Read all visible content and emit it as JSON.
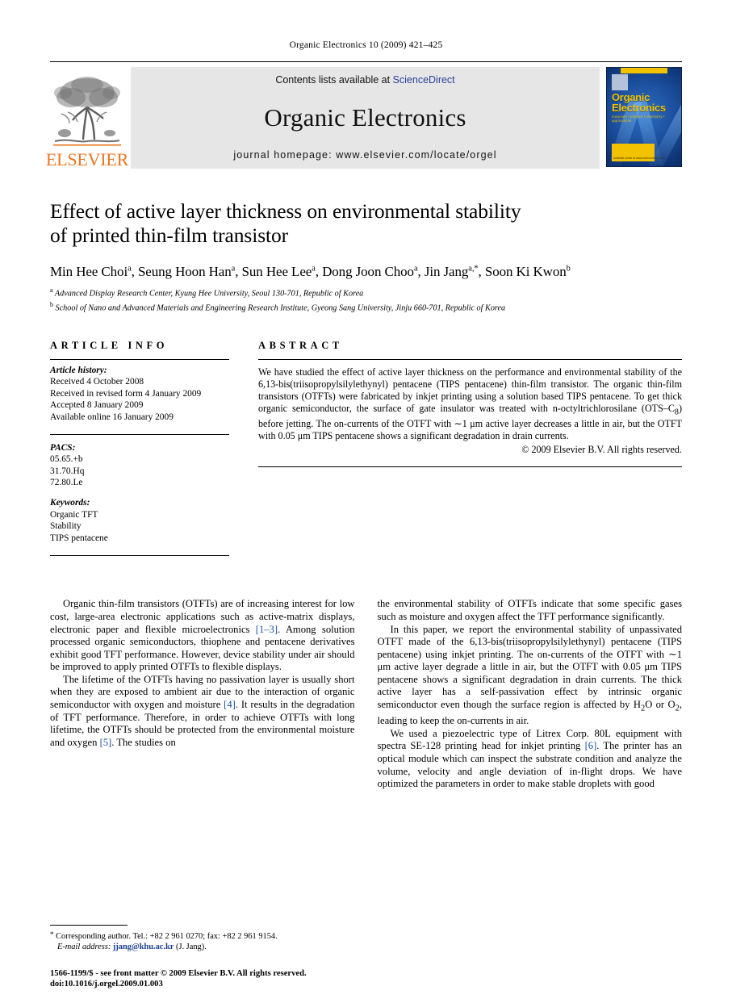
{
  "running_head": "Organic Electronics 10 (2009) 421–425",
  "banner": {
    "publisher_wordmark": "ELSEVIER",
    "contents_prefix": "Contents lists available at ",
    "contents_link": "ScienceDirect",
    "journal_title": "Organic Electronics",
    "homepage": "journal homepage: www.elsevier.com/locate/orgel",
    "cover_title_line1": "Organic",
    "cover_title_line2": "Electronics",
    "cover_subtitle": "materials • physics • chemistry • applications",
    "cover_footer": "available online at www.sciencedirect.com"
  },
  "article": {
    "title_line1": "Effect of active layer thickness on environmental stability",
    "title_line2": "of printed thin-film transistor",
    "authors": [
      {
        "name": "Min Hee Choi",
        "mark": "a"
      },
      {
        "name": "Seung Hoon Han",
        "mark": "a"
      },
      {
        "name": "Sun Hee Lee",
        "mark": "a"
      },
      {
        "name": "Dong Joon Choo",
        "mark": "a"
      },
      {
        "name": "Jin Jang",
        "mark": "a,*"
      },
      {
        "name": "Soon Ki Kwon",
        "mark": "b"
      }
    ],
    "affiliations": [
      {
        "mark": "a",
        "text": "Advanced Display Research Center, Kyung Hee University, Seoul 130-701, Republic of Korea"
      },
      {
        "mark": "b",
        "text": "School of Nano and Advanced Materials and Engineering Research Institute, Gyeong Sang University, Jinju 660-701, Republic of Korea"
      }
    ]
  },
  "info": {
    "heading": "ARTICLE INFO",
    "history_label": "Article history:",
    "history": [
      "Received 4 October 2008",
      "Received in revised form 4 January 2009",
      "Accepted 8 January 2009",
      "Available online 16 January 2009"
    ],
    "pacs_label": "PACS:",
    "pacs": [
      "05.65.+b",
      "31.70.Hq",
      "72.80.Le"
    ],
    "keywords_label": "Keywords:",
    "keywords": [
      "Organic TFT",
      "Stability",
      "TIPS pentacene"
    ]
  },
  "abstract": {
    "heading": "ABSTRACT",
    "text_part1": "We have studied the effect of active layer thickness on the performance and environmental stability of the 6,13-bis(triisopropylsilylethynyl) pentacene (TIPS pentacene) thin-film transistor. The organic thin-film transistors (OTFTs) were fabricated by inkjet printing using a solution based TIPS pentacene. To get thick organic semiconductor, the surface of gate insulator was treated with n-octyltrichlorosilane (OTS–C",
    "sub1": "8",
    "text_part2": ") before jetting. The on-currents of the OTFT with ∼1 μm active layer decreases a little in air, but the OTFT with 0.05 μm TIPS pentacene shows a significant degradation in drain currents.",
    "copyright": "© 2009 Elsevier B.V. All rights reserved."
  },
  "body": {
    "left": {
      "p1_a": "Organic thin-film transistors (OTFTs) are of increasing interest for low cost, large-area electronic applications such as active-matrix displays, electronic paper and flexible microelectronics ",
      "p1_ref": "[1–3]",
      "p1_b": ". Among solution processed organic semiconductors, thiophene and pentacene derivatives exhibit good TFT performance. However, device stability under air should be improved to apply printed OTFTs to flexible displays.",
      "p2_a": "The lifetime of the OTFTs having no passivation layer is usually short when they are exposed to ambient air due to the interaction of organic semiconductor with oxygen and moisture ",
      "p2_ref1": "[4]",
      "p2_b": ". It results in the degradation of TFT performance. Therefore, in order to achieve OTFTs with long lifetime, the OTFTs should be protected from the environmental moisture and oxygen ",
      "p2_ref2": "[5]",
      "p2_c": ". The studies on"
    },
    "right": {
      "p1": "the environmental stability of OTFTs indicate that some specific gases such as moisture and oxygen affect the TFT performance significantly.",
      "p2_a": "In this paper, we report the environmental stability of unpassivated OTFT made of the 6,13-bis(triisopropylsilylethynyl) pentacene (TIPS pentacene) using inkjet printing. The on-currents of the OTFT with ∼1 μm active layer degrade a little in air, but the OTFT with 0.05 μm TIPS pentacene shows a significant degradation in drain currents. The thick active layer has a self-passivation effect by intrinsic organic semiconductor even though the surface region is affected by H",
      "p2_sub1": "2",
      "p2_b": "O or O",
      "p2_sub2": "2",
      "p2_c": ", leading to keep the on-currents in air.",
      "p3_a": "We used a piezoelectric type of Litrex Corp. 80L equipment with spectra SE-128 printing head for inkjet printing ",
      "p3_ref": "[6]",
      "p3_b": ". The printer has an optical module which can inspect the substrate condition and analyze the volume, velocity and angle deviation of in-flight drops. We have optimized the parameters in order to make stable droplets with good"
    }
  },
  "footnote": {
    "marker": "*",
    "text": "Corresponding author. Tel.: +82 2 961 0270; fax: +82 2 961 9154.",
    "email_label": "E-mail address:",
    "email": "jjang@khu.ac.kr",
    "email_suffix": "(J. Jang)."
  },
  "imprint": {
    "issn_line": "1566-1199/$ - see front matter © 2009 Elsevier B.V. All rights reserved.",
    "doi_line": "doi:10.1016/j.orgel.2009.01.003"
  },
  "colors": {
    "elsevier_orange": "#E87722",
    "link_blue": "#1a4fa0",
    "sciencedirect_blue": "#2b3f9e",
    "banner_gray": "#e6e6e6",
    "cover_navy": "#0d2f6e",
    "cover_yellow": "#f2c200"
  }
}
